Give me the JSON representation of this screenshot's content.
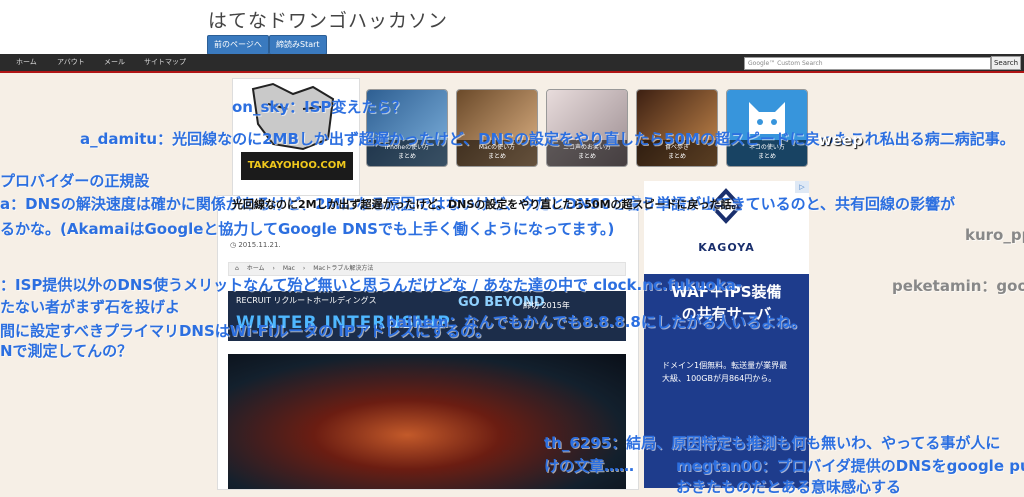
{
  "header": {
    "title": "はてなドワンゴハッカソン",
    "prev_button": "前のページへ",
    "start_button": "締読みStart"
  },
  "nav": {
    "items": [
      "ホーム",
      "アバウト",
      "メール",
      "サイトマップ"
    ],
    "search_placeholder": "Google™ Custom Search",
    "search_button": "Search"
  },
  "thumbs": [
    {
      "label": "iPhoneの使い方\nまとめ",
      "color": "#4a7fae"
    },
    {
      "label": "Macの使い方\nまとめ",
      "color": "#a36b3d"
    },
    {
      "label": "ニコ声のお笑い方\nまとめ",
      "color": "#d7c8ca"
    },
    {
      "label": "食べ歩き\nまとめ",
      "color": "#8c4a24"
    },
    {
      "label": "ネコの使い方\nまとめ",
      "color": "#3795dc"
    }
  ],
  "article": {
    "date": "2015.11.21.",
    "breadcrumbs": [
      "ホーム",
      "Mac",
      "Macトラブル解決方法"
    ],
    "banner": {
      "recruit": "RECRUIT リクルートホールディングス",
      "go_beyond": "GO BEYOND",
      "winter": "WINTER INTERNSHIP",
      "deadline": "締切 2015年"
    },
    "logo_text": "TAKAYOHOO.COM"
  },
  "ad": {
    "brand": "KAGOYA",
    "headline": "WAF＋IPS装備\nの共有サーバ",
    "desc": "ドメイン1個無料。転送量が業界最大級、100GBが月864円から。"
  },
  "comments": [
    {
      "text": "on_sky：ISP変えたら？",
      "style": "blue"
    },
    {
      "text": "a_damitu：光回線なのに2MBしか出ず超遅かったけど、DNSの設定をやり直したら50Mの超スピードに戻ったこれ私出る病二病記事。",
      "style": "blue"
    },
    {
      "text": "weep",
      "style": "white"
    },
    {
      "text": "プロバイダーの正規設",
      "style": "blue"
    },
    {
      "text": "a：DNSの解決速度は確かに関係があるけど、2Mになる原因ではないけど、今だとDNS0と言う単語が出てきているのと、共有回線の影響が",
      "style": "blue"
    },
    {
      "text": "るかな。(AkamaiはGoogleと協力してGoogle DNSでも上手く働くようになってます。)",
      "style": "blue"
    },
    {
      "text": "光回線なのに2Mしか出ず超遅かったけど、DNSの設定をやり直したら50Mの超スピードに戻った話。",
      "style": "dark"
    },
    {
      "text": "kuro_pp",
      "style": "grey"
    },
    {
      "text": "：ISP提供以外のDNS使うメリットなんて殆ど無いと思うんだけどな / あなた達の中で clock.nc.fukuoka-",
      "style": "blue"
    },
    {
      "text": "peketamin：goo",
      "style": "grey"
    },
    {
      "text": "たない者がまず石を投げよ",
      "style": "blue"
    },
    {
      "text": "baihem：なんでもかんでも8.8.8.8にしたがる人いるよね。",
      "style": "blue"
    },
    {
      "text": "間に設定すべきプライマリDNSはWi-Fiルータの IPアドレスにするの。",
      "style": "blue"
    },
    {
      "text": "Nで測定してんの？",
      "style": "blue"
    },
    {
      "text": "th_6295：結局、原因特定も推測も何も無いわ、やってる事が人に",
      "style": "blue"
    },
    {
      "text": "けの文章……",
      "style": "blue"
    },
    {
      "text": "megtan00：プロバイダ提供のDNSをgoogle pu",
      "style": "blue"
    },
    {
      "text": "おきたものだとある意味感心する",
      "style": "blue"
    }
  ]
}
